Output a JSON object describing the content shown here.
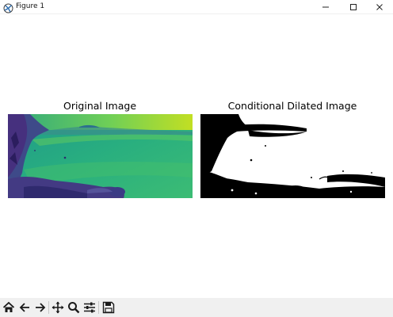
{
  "window": {
    "title": "Figure 1",
    "app_icon": "matplotlib-figure-icon",
    "controls": [
      "minimize-icon",
      "maximize-icon",
      "close-icon"
    ]
  },
  "figure": {
    "panels": [
      {
        "title": "Original Image",
        "colormap": "viridis"
      },
      {
        "title": "Conditional Dilated Image",
        "colormap": "gray (binary)"
      }
    ]
  },
  "toolbar": {
    "tools": [
      "home-icon",
      "back-arrow-icon",
      "forward-arrow-icon",
      "pan-icon",
      "zoom-icon",
      "subplots-config-icon",
      "save-icon"
    ]
  },
  "colors": {
    "toolbar_bg": "#f0f0f0",
    "toolbar_icon": "#1a1a1a",
    "viridis_dark": "#3b3b85",
    "viridis_mid": "#21a685",
    "viridis_light": "#a8db34"
  }
}
